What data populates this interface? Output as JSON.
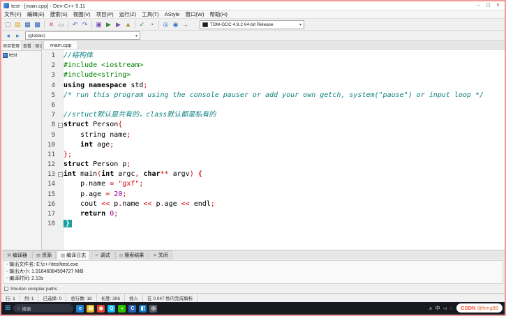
{
  "window": {
    "title": "test - [main.cpp] - Dev-C++ 5.11",
    "controls": [
      {
        "name": "minimize-button",
        "glyph": "–"
      },
      {
        "name": "maximize-button",
        "glyph": "▢"
      },
      {
        "name": "close-button",
        "glyph": "✕"
      }
    ]
  },
  "menu": {
    "items": [
      "文件(F)",
      "编辑(E)",
      "搜索(S)",
      "视图(V)",
      "项目(P)",
      "运行(Z)",
      "工具(T)",
      "AStyle",
      "窗口(W)",
      "帮助(H)"
    ]
  },
  "toolbar": {
    "icons": [
      {
        "name": "new-file-icon",
        "glyph": "▢",
        "color": "#8a8a8a"
      },
      {
        "name": "open-file-icon",
        "glyph": "▤",
        "color": "#d9a21b"
      },
      {
        "name": "save-icon",
        "glyph": "▦",
        "color": "#2b5fb8"
      },
      {
        "name": "save-all-icon",
        "glyph": "▩",
        "color": "#2b5fb8"
      },
      {
        "sep": true
      },
      {
        "name": "close-file-icon",
        "glyph": "✕",
        "color": "#c05050"
      },
      {
        "name": "print-icon",
        "glyph": "▭",
        "color": "#777777"
      },
      {
        "sep": true
      },
      {
        "name": "undo-icon",
        "glyph": "↶",
        "color": "#3a6fc4"
      },
      {
        "name": "redo-icon",
        "glyph": "↷",
        "color": "#3a6fc4"
      },
      {
        "sep": true
      },
      {
        "name": "compile-icon",
        "glyph": "▣",
        "color": "#7a4fb0"
      },
      {
        "name": "run-icon",
        "glyph": "▶",
        "color": "#2e8b2e"
      },
      {
        "name": "compile-run-icon",
        "glyph": "▶",
        "color": "#7a4fb0"
      },
      {
        "name": "rebuild-icon",
        "glyph": "▲",
        "color": "#c07a1a"
      },
      {
        "sep": true
      },
      {
        "name": "debug-icon",
        "glyph": "✓",
        "color": "#2e8b2e"
      },
      {
        "name": "profile-icon",
        "glyph": "◔",
        "color": "#b03060"
      },
      {
        "sep": true
      },
      {
        "name": "find-icon",
        "glyph": "◎",
        "color": "#3a6fc4"
      },
      {
        "name": "replace-icon",
        "glyph": "◉",
        "color": "#3a6fc4"
      },
      {
        "name": "goto-icon",
        "glyph": "→",
        "color": "#777777"
      }
    ],
    "compiler_combo": {
      "value": "TDM-GCC 4.9.2 64-bit Release",
      "arrow": "▾"
    },
    "nav_icons": [
      {
        "name": "back-icon",
        "glyph": "◂",
        "color": "#3a6fc4"
      },
      {
        "name": "forward-icon",
        "glyph": "▸",
        "color": "#3a6fc4"
      }
    ],
    "class_combo": {
      "value": "(globals)",
      "arrow": "▾"
    }
  },
  "left_panel": {
    "tabs": [
      "项目管理",
      "查看",
      "调试"
    ],
    "active_tab": "项目管理",
    "project_name": "test"
  },
  "editor": {
    "tab": "main.cpp",
    "lines": [
      {
        "n": 1,
        "seg": [
          {
            "t": "//结构体",
            "c": "cm"
          }
        ]
      },
      {
        "n": 2,
        "seg": [
          {
            "t": "#include <iostream>",
            "c": "pp"
          }
        ]
      },
      {
        "n": 3,
        "seg": [
          {
            "t": "#include<string>",
            "c": "pp"
          }
        ]
      },
      {
        "n": 4,
        "seg": [
          {
            "t": "using",
            "c": "kw"
          },
          {
            "t": " ",
            "c": "pl"
          },
          {
            "t": "namespace",
            "c": "kw"
          },
          {
            "t": " std",
            "c": "pl"
          },
          {
            "t": ";",
            "c": "sym"
          }
        ]
      },
      {
        "n": 5,
        "seg": [
          {
            "t": "/* run this program using the console pauser or add your own getch, system(\"pause\") or input loop */",
            "c": "cm"
          }
        ]
      },
      {
        "n": 6,
        "seg": []
      },
      {
        "n": 7,
        "seg": [
          {
            "t": "//srtuct默认是共有的，class默认都是私有的",
            "c": "cm"
          }
        ]
      },
      {
        "n": 8,
        "fold": true,
        "seg": [
          {
            "t": "struct",
            "c": "kw"
          },
          {
            "t": " Person",
            "c": "pl"
          },
          {
            "t": "{",
            "c": "sym"
          }
        ]
      },
      {
        "n": 9,
        "seg": [
          {
            "t": "    string name",
            "c": "pl"
          },
          {
            "t": ";",
            "c": "sym"
          }
        ]
      },
      {
        "n": 10,
        "seg": [
          {
            "t": "    ",
            "c": "pl"
          },
          {
            "t": "int",
            "c": "kw"
          },
          {
            "t": " age",
            "c": "pl"
          },
          {
            "t": ";",
            "c": "sym"
          }
        ]
      },
      {
        "n": 11,
        "seg": [
          {
            "t": "}",
            "c": "sym"
          },
          {
            "t": ";",
            "c": "sym"
          }
        ]
      },
      {
        "n": 12,
        "seg": [
          {
            "t": "struct",
            "c": "kw"
          },
          {
            "t": " Person p",
            "c": "pl"
          },
          {
            "t": ";",
            "c": "sym"
          }
        ]
      },
      {
        "n": 13,
        "fold": true,
        "seg": [
          {
            "t": "int",
            "c": "kw"
          },
          {
            "t": " main",
            "c": "pl"
          },
          {
            "t": "(",
            "c": "sym"
          },
          {
            "t": "int",
            "c": "kw"
          },
          {
            "t": " argc",
            "c": "pl"
          },
          {
            "t": ",",
            "c": "sym"
          },
          {
            "t": " ",
            "c": "pl"
          },
          {
            "t": "char",
            "c": "kw"
          },
          {
            "t": "**",
            "c": "sym"
          },
          {
            "t": " argv",
            "c": "pl"
          },
          {
            "t": ")",
            "c": "sym"
          },
          {
            "t": " ",
            "c": "pl"
          },
          {
            "t": "{",
            "c": "brace"
          }
        ]
      },
      {
        "n": 14,
        "seg": [
          {
            "t": "    p",
            "c": "pl"
          },
          {
            "t": ".",
            "c": "sym"
          },
          {
            "t": "name ",
            "c": "pl"
          },
          {
            "t": "=",
            "c": "sym"
          },
          {
            "t": " ",
            "c": "pl"
          },
          {
            "t": "\"gxf\"",
            "c": "str"
          },
          {
            "t": ";",
            "c": "sym"
          }
        ]
      },
      {
        "n": 15,
        "seg": [
          {
            "t": "    p",
            "c": "pl"
          },
          {
            "t": ".",
            "c": "sym"
          },
          {
            "t": "age ",
            "c": "pl"
          },
          {
            "t": "=",
            "c": "sym"
          },
          {
            "t": " ",
            "c": "pl"
          },
          {
            "t": "20",
            "c": "num"
          },
          {
            "t": ";",
            "c": "sym"
          }
        ]
      },
      {
        "n": 16,
        "seg": [
          {
            "t": "    cout ",
            "c": "pl"
          },
          {
            "t": "<<",
            "c": "sym"
          },
          {
            "t": " p",
            "c": "pl"
          },
          {
            "t": ".",
            "c": "sym"
          },
          {
            "t": "name ",
            "c": "pl"
          },
          {
            "t": "<<",
            "c": "sym"
          },
          {
            "t": " p",
            "c": "pl"
          },
          {
            "t": ".",
            "c": "sym"
          },
          {
            "t": "age ",
            "c": "pl"
          },
          {
            "t": "<<",
            "c": "sym"
          },
          {
            "t": " endl",
            "c": "pl"
          },
          {
            "t": ";",
            "c": "sym"
          }
        ]
      },
      {
        "n": 17,
        "seg": [
          {
            "t": "    ",
            "c": "pl"
          },
          {
            "t": "return",
            "c": "kw"
          },
          {
            "t": " ",
            "c": "pl"
          },
          {
            "t": "0",
            "c": "num"
          },
          {
            "t": ";",
            "c": "sym"
          }
        ]
      },
      {
        "n": 18,
        "seg": [
          {
            "t": "}",
            "c": "brhl"
          }
        ]
      }
    ]
  },
  "bottom_panel": {
    "tabs": [
      {
        "name": "tab-compiler",
        "icon": "⚒",
        "label": "编译器"
      },
      {
        "name": "tab-resources",
        "icon": "▤",
        "label": "资源"
      },
      {
        "name": "tab-compile-log",
        "icon": "▥",
        "label": "编译日志"
      },
      {
        "name": "tab-debug",
        "icon": "✓",
        "label": "调试"
      },
      {
        "name": "tab-find-results",
        "icon": "◎",
        "label": "搜索结果"
      },
      {
        "name": "tab-close",
        "icon": "✕",
        "label": "关闭"
      }
    ],
    "active_tab": "编译日志",
    "log_lines": [
      "- 输出文件名: E:\\c++\\test\\test.exe",
      "- 输出大小: 1.91846084594727 MiB",
      "- 编译时间: 2.13s"
    ],
    "shorten_paths_label": "Shorten compiler paths"
  },
  "statusbar": {
    "segments": [
      "行: 1",
      "列: 1",
      "已选择: 0",
      "总行数: 18",
      "长度: 306",
      "插入",
      "在 0.047 秒内完成解析"
    ]
  },
  "taskbar": {
    "start_glyph": "⊞",
    "search_icon": "○",
    "search_label": "搜索",
    "icons": [
      {
        "name": "edge-icon",
        "glyph": "e",
        "bg": "#1b7fd4",
        "color": "#ffffff"
      },
      {
        "name": "explorer-icon",
        "glyph": "▤",
        "bg": "#e8b71a",
        "color": "#ffffff"
      },
      {
        "name": "chrome-icon",
        "glyph": "◉",
        "bg": "#e84335",
        "color": "#ffffff"
      },
      {
        "name": "qq-icon",
        "glyph": "Q",
        "bg": "#12b7f5",
        "color": "#ffffff"
      },
      {
        "name": "wechat-icon",
        "glyph": "◖",
        "bg": "#2dc100",
        "color": "#ffffff"
      },
      {
        "name": "devcpp-icon",
        "glyph": "C",
        "bg": "#2b5fb8",
        "color": "#ffffff"
      },
      {
        "name": "vscode-icon",
        "glyph": "◧",
        "bg": "#0a7bc2",
        "color": "#ffffff"
      },
      {
        "name": "steam-icon",
        "glyph": "◎",
        "bg": "#555c66",
        "color": "#ffffff"
      }
    ],
    "tray": [
      {
        "name": "tray-chevron-icon",
        "glyph": "∧"
      },
      {
        "name": "ime-indicator",
        "glyph": "中"
      },
      {
        "name": "volume-icon",
        "glyph": "◅"
      },
      {
        "name": "network-icon",
        "glyph": "◌"
      }
    ]
  },
  "watermark": {
    "brand": "CSDN",
    "handle": "@feng88"
  }
}
